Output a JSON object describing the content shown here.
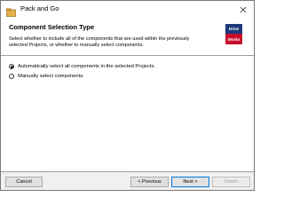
{
  "window": {
    "title": "Pack and Go",
    "app_icon": "pack-and-go-icon",
    "close_icon": "close-icon"
  },
  "header": {
    "title": "Component Selection Type",
    "description": "Select whether to include all of the components that are used within the previously selected Projects, or whether to manually select components.",
    "logo": {
      "line1": "Drive",
      "line2": "Works",
      "colors": {
        "top": "#1c3a7a",
        "bottom": "#c8102e"
      }
    }
  },
  "options": [
    {
      "label": "Automatically select all components in the selected Projects.",
      "selected": true
    },
    {
      "label": "Manually select components.",
      "selected": false
    }
  ],
  "buttons": {
    "cancel": "Cancel",
    "previous": "< Previous",
    "next": "Next >",
    "finish": "Finish"
  },
  "colors": {
    "accent": "#0078d7"
  }
}
